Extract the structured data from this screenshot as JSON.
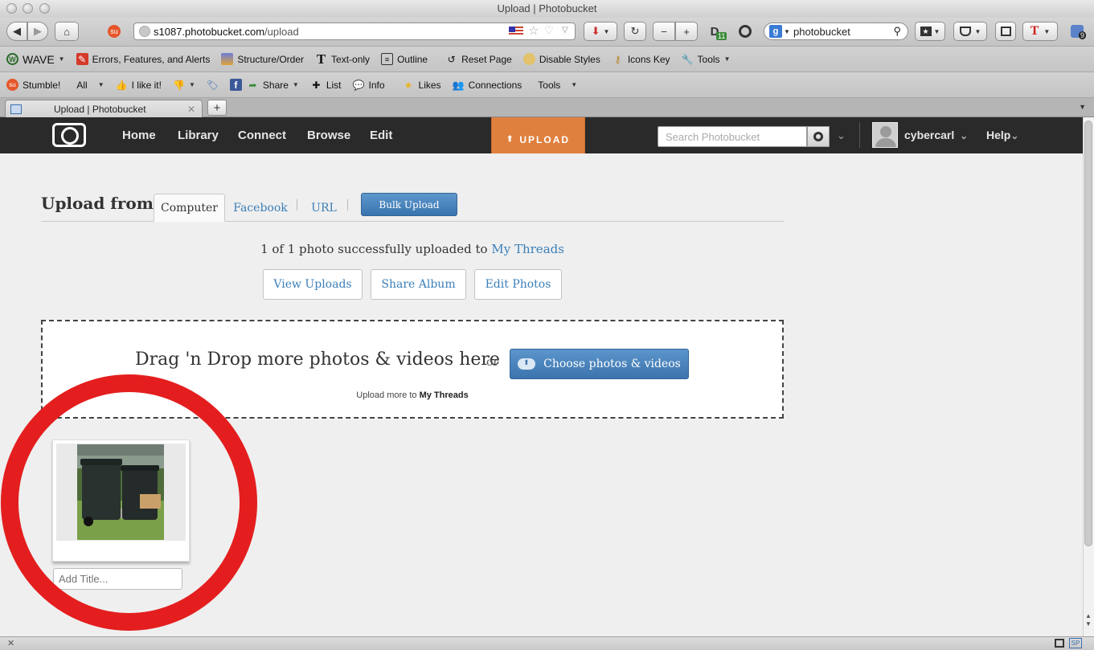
{
  "window": {
    "title": "Upload | Photobucket"
  },
  "browser": {
    "url_host": "s1087.photobucket.com",
    "url_path": "/upload",
    "search_value": "photobucket",
    "badge_d": "11",
    "badge_ext": "9",
    "tab_title": "Upload | Photobucket"
  },
  "wave_toolbar": {
    "wave": "WAVE",
    "items": [
      "Errors, Features, and Alerts",
      "Structure/Order",
      "Text-only",
      "Outline",
      "Reset Page",
      "Disable Styles",
      "Icons Key",
      "Tools"
    ]
  },
  "stumble_toolbar": {
    "stumble": "Stumble!",
    "all": "All",
    "like": "I like it!",
    "share": "Share",
    "list": "List",
    "info": "Info",
    "likes": "Likes",
    "connections": "Connections",
    "tools": "Tools"
  },
  "pb_header": {
    "nav": [
      "Home",
      "Library",
      "Connect",
      "Browse",
      "Edit"
    ],
    "upload": "UPLOAD",
    "search_placeholder": "Search Photobucket",
    "username": "cybercarl",
    "help": "Help"
  },
  "upload_page": {
    "upload_from": "Upload from:",
    "tabs": [
      "Computer",
      "Facebook",
      "URL"
    ],
    "bulk_upload": "Bulk Upload",
    "success_prefix": "1 of 1 photo successfully uploaded to",
    "album_name": "My Threads",
    "actions": [
      "View Uploads",
      "Share Album",
      "Edit Photos"
    ],
    "dropzone_text": "Drag 'n Drop more photos & videos here",
    "or": "or",
    "choose_button": "Choose photos & videos",
    "upload_more_prefix": "Upload more to",
    "title_placeholder": "Add Title..."
  },
  "colors": {
    "upload_orange": "#e0803e",
    "link_blue": "#3b7fb8",
    "button_blue": "#3c74ad",
    "highlight_red": "#e41e1e",
    "header_dark": "#2a2a2a"
  }
}
